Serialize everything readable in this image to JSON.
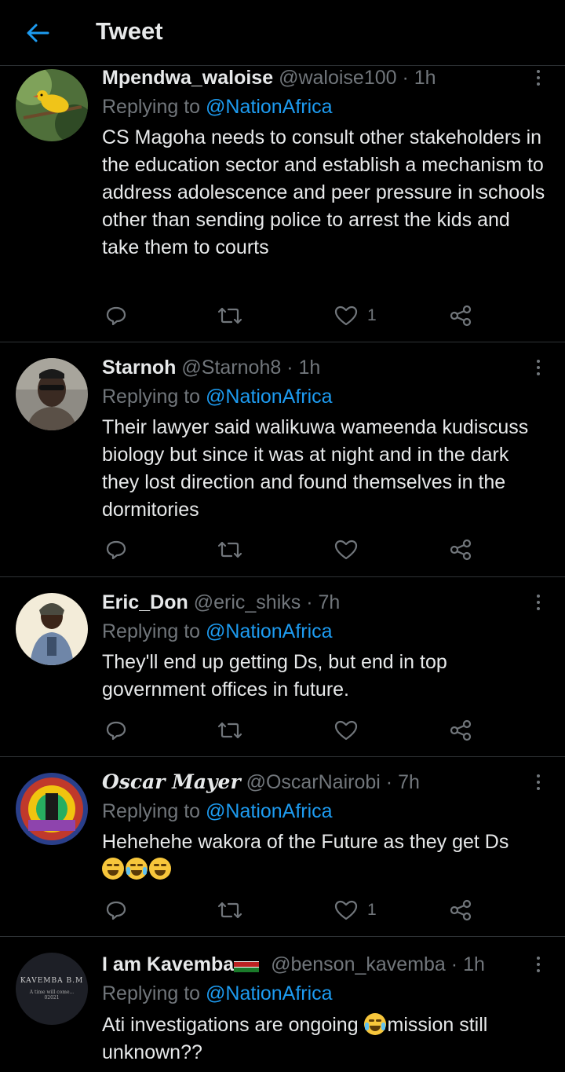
{
  "header": {
    "title": "Tweet",
    "back_icon": "arrow-left-icon"
  },
  "colors": {
    "accent": "#1d9bf0",
    "muted": "#71767b",
    "text": "#e7e9ea",
    "background": "#000000",
    "divider": "#2f3336"
  },
  "replying_label": "Replying to",
  "tweets": [
    {
      "name": "Mpendwa_waloise",
      "handle": "@waloise100",
      "time": "· 1h",
      "reply_to": "@NationAfrica",
      "text": "CS Magoha needs to consult other stakeholders in the education sector and establish a mechanism to address adolescence and peer pressure in schools other than sending police to arrest the kids and take them to courts",
      "likes": "1"
    },
    {
      "name": "Starnoh",
      "handle": "@Starnoh8",
      "time": "· 1h",
      "reply_to": "@NationAfrica",
      "text": "Their lawyer said walikuwa wameenda kudiscuss biology but since it was at night and in the dark they lost direction and found themselves in the dormitories",
      "likes": ""
    },
    {
      "name": "Eric_Don",
      "handle": "@eric_shiks",
      "time": "· 7h",
      "reply_to": "@NationAfrica",
      "text": "They'll end up getting Ds, but end in top government offices in future.",
      "likes": ""
    },
    {
      "name": "Oscar Mayer",
      "handle": "@OscarNairobi",
      "time": "· 7h",
      "reply_to": "@NationAfrica",
      "text": "Hehehehe wakora of the Future as they get Ds",
      "likes": "1"
    },
    {
      "name": "I am Kavemba",
      "handle": "@benson_kavemba",
      "time": "· 1h",
      "reply_to": "@NationAfrica",
      "text_before": "Ati investigations are ongoing ",
      "text_after": "mission still unknown??",
      "likes": "",
      "avatar_text": {
        "line1": "KAVEMBA B.M",
        "line2": "A time will come...",
        "line3": "02021"
      }
    }
  ]
}
